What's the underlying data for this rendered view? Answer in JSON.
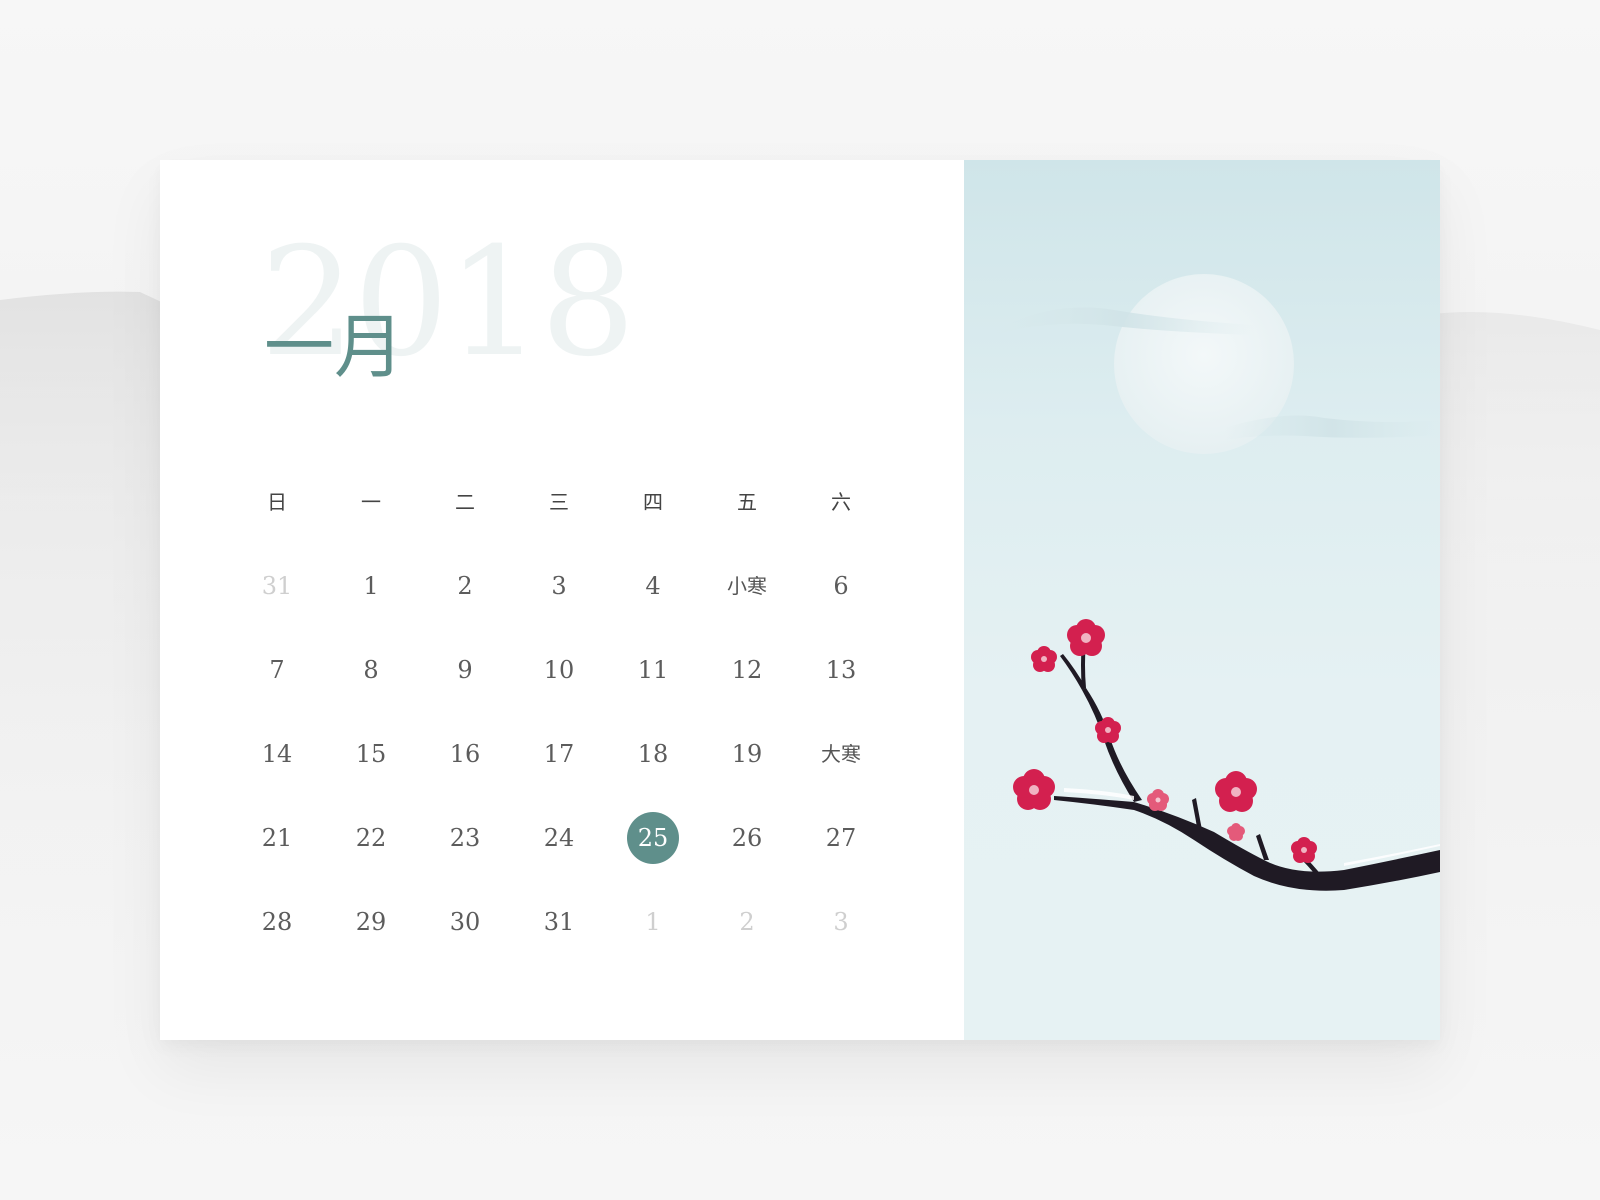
{
  "calendar": {
    "year": "2018",
    "month": "一月",
    "weekdays": [
      "日",
      "一",
      "二",
      "三",
      "四",
      "五",
      "六"
    ],
    "weeks": [
      [
        {
          "label": "31",
          "state": "muted"
        },
        {
          "label": "1",
          "state": "normal"
        },
        {
          "label": "2",
          "state": "normal"
        },
        {
          "label": "3",
          "state": "normal"
        },
        {
          "label": "4",
          "state": "normal"
        },
        {
          "label": "小寒",
          "state": "term"
        },
        {
          "label": "6",
          "state": "normal"
        }
      ],
      [
        {
          "label": "7",
          "state": "normal"
        },
        {
          "label": "8",
          "state": "normal"
        },
        {
          "label": "9",
          "state": "normal"
        },
        {
          "label": "10",
          "state": "normal"
        },
        {
          "label": "11",
          "state": "normal"
        },
        {
          "label": "12",
          "state": "normal"
        },
        {
          "label": "13",
          "state": "normal"
        }
      ],
      [
        {
          "label": "14",
          "state": "normal"
        },
        {
          "label": "15",
          "state": "normal"
        },
        {
          "label": "16",
          "state": "normal"
        },
        {
          "label": "17",
          "state": "normal"
        },
        {
          "label": "18",
          "state": "normal"
        },
        {
          "label": "19",
          "state": "normal"
        },
        {
          "label": "大寒",
          "state": "term"
        }
      ],
      [
        {
          "label": "21",
          "state": "normal"
        },
        {
          "label": "22",
          "state": "normal"
        },
        {
          "label": "23",
          "state": "normal"
        },
        {
          "label": "24",
          "state": "normal"
        },
        {
          "label": "25",
          "state": "today"
        },
        {
          "label": "26",
          "state": "normal"
        },
        {
          "label": "27",
          "state": "normal"
        }
      ],
      [
        {
          "label": "28",
          "state": "normal"
        },
        {
          "label": "29",
          "state": "normal"
        },
        {
          "label": "30",
          "state": "normal"
        },
        {
          "label": "31",
          "state": "normal"
        },
        {
          "label": "1",
          "state": "muted"
        },
        {
          "label": "2",
          "state": "muted"
        },
        {
          "label": "3",
          "state": "muted"
        }
      ]
    ]
  },
  "colors": {
    "accent": "#5f8f8b",
    "year_watermark": "#eef3f3",
    "muted_day": "#cfcfcf",
    "blossom": "#d3204f",
    "branch": "#1f1a24",
    "sky_top": "#cfe5e9",
    "sky_bottom": "#e6f2f3"
  },
  "illustration": {
    "subject": "plum-blossom-branch",
    "moon": "pale-moon",
    "clouds": "mist-clouds"
  }
}
